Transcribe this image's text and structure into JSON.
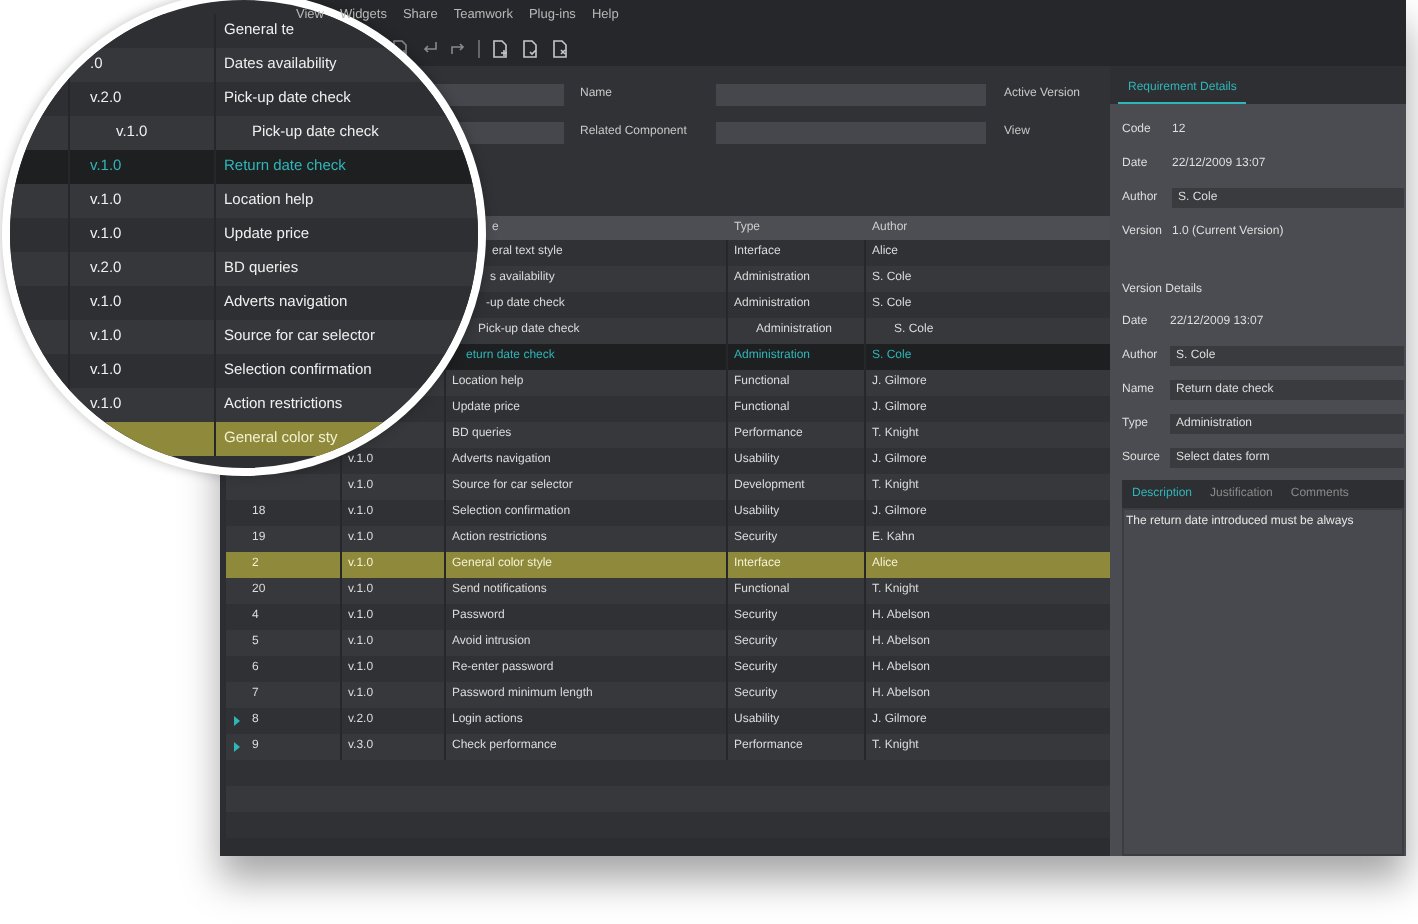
{
  "menu": [
    "View",
    "Widgets",
    "Share",
    "Teamwork",
    "Plug-ins",
    "Help"
  ],
  "form": [
    {
      "label": "Name",
      "side_label": "Active Version"
    },
    {
      "label": "Related Component",
      "side_label": "View"
    }
  ],
  "table": {
    "headers": {
      "name": "e",
      "type": "Type",
      "author": "Author"
    },
    "rows": [
      {
        "name": "eral text style",
        "type": "Interface",
        "author": "Alice",
        "selected": false,
        "highlighted": false
      },
      {
        "name": "s availability",
        "type": "Administration",
        "author": "S. Cole",
        "selected": false,
        "highlighted": false
      },
      {
        "name": "-up date check",
        "type": "Administration",
        "author": "S. Cole",
        "selected": false,
        "highlighted": false,
        "children": [
          {
            "name": "Pick-up date check",
            "type": "Administration",
            "author": "S. Cole",
            "selected": false,
            "highlighted": false
          }
        ]
      },
      {
        "name": "eturn date check",
        "type": "Administration",
        "author": "S. Cole",
        "selected": true,
        "highlighted": false
      },
      {
        "name": "Location help",
        "type": "Functional",
        "author": "J. Gilmore",
        "selected": false,
        "highlighted": false
      },
      {
        "name": "Update price",
        "type": "Functional",
        "author": "J. Gilmore",
        "selected": false,
        "highlighted": false
      },
      {
        "name": "BD queries",
        "type": "Performance",
        "author": "T. Knight",
        "selected": false,
        "highlighted": false
      },
      {
        "version": "v.1.0",
        "name": "Adverts navigation",
        "type": "Usability",
        "author": "J. Gilmore",
        "selected": false,
        "highlighted": false
      },
      {
        "version": "v.1.0",
        "name": "Source for car selector",
        "type": "Development",
        "author": "T. Knight",
        "selected": false,
        "highlighted": false
      },
      {
        "code": "18",
        "version": "v.1.0",
        "name": "Selection confirmation",
        "type": "Usability",
        "author": "J. Gilmore",
        "selected": false,
        "highlighted": false
      },
      {
        "code": "19",
        "version": "v.1.0",
        "name": "Action restrictions",
        "type": "Security",
        "author": "E. Kahn",
        "selected": false,
        "highlighted": false
      },
      {
        "code": "2",
        "version": "v.1.0",
        "name": "General color style",
        "type": "Interface",
        "author": "Alice",
        "selected": false,
        "highlighted": true
      },
      {
        "code": "20",
        "version": "v.1.0",
        "name": "Send notifications",
        "type": "Functional",
        "author": "T. Knight",
        "selected": false,
        "highlighted": false
      },
      {
        "code": "4",
        "version": "v.1.0",
        "name": "Password",
        "type": "Security",
        "author": "H. Abelson",
        "selected": false,
        "highlighted": false
      },
      {
        "code": "5",
        "version": "v.1.0",
        "name": "Avoid intrusion",
        "type": "Security",
        "author": "H. Abelson",
        "selected": false,
        "highlighted": false
      },
      {
        "code": "6",
        "version": "v.1.0",
        "name": "Re-enter password",
        "type": "Security",
        "author": "H. Abelson",
        "selected": false,
        "highlighted": false
      },
      {
        "code": "7",
        "version": "v.1.0",
        "name": "Password minimum length",
        "type": "Security",
        "author": "H. Abelson",
        "selected": false,
        "highlighted": false
      },
      {
        "code": "8",
        "version": "v.2.0",
        "name": "Login actions",
        "type": "Usability",
        "author": "J. Gilmore",
        "selected": false,
        "highlighted": false,
        "expanded": false
      },
      {
        "code": "9",
        "version": "v.3.0",
        "name": "Check performance",
        "type": "Performance",
        "author": "T. Knight",
        "selected": false,
        "highlighted": false,
        "expanded": false
      }
    ]
  },
  "magnifier": {
    "rows": [
      {
        "name": "General te",
        "selected": false,
        "highlighted": false
      },
      {
        "version": ".0",
        "name": "Dates availability",
        "selected": false,
        "highlighted": false
      },
      {
        "version": "v.2.0",
        "name": "Pick-up date check",
        "selected": false,
        "highlighted": false,
        "children": [
          {
            "version": "v.1.0",
            "name": "Pick-up date check",
            "selected": false,
            "highlighted": false
          }
        ]
      },
      {
        "version": "v.1.0",
        "name": "Return date check",
        "selected": true,
        "highlighted": false
      },
      {
        "version": "v.1.0",
        "name": "Location help",
        "selected": false,
        "highlighted": false
      },
      {
        "version": "v.1.0",
        "name": "Update price",
        "selected": false,
        "highlighted": false
      },
      {
        "version": "v.2.0",
        "name": "BD queries",
        "selected": false,
        "highlighted": false
      },
      {
        "version": "v.1.0",
        "name": "Adverts navigation",
        "selected": false,
        "highlighted": false
      },
      {
        "version": "v.1.0",
        "name": "Source for car selector",
        "selected": false,
        "highlighted": false
      },
      {
        "version": "v.1.0",
        "name": "Selection confirmation",
        "selected": false,
        "highlighted": false
      },
      {
        "version": "v.1.0",
        "name": "Action restrictions",
        "selected": false,
        "highlighted": false
      },
      {
        "name": "General color sty",
        "selected": false,
        "highlighted": true
      }
    ]
  },
  "details": {
    "tabs": [
      {
        "label": "Requirement Details",
        "selected": true
      }
    ],
    "fields": [
      {
        "kind": "text",
        "label": "Code",
        "value": "12"
      },
      {
        "kind": "text",
        "label": "Date",
        "value": "22/12/2009 13:07"
      },
      {
        "kind": "input",
        "label": "Author",
        "value": "S. Cole"
      },
      {
        "kind": "text",
        "label": "Version",
        "value": "1.0 (Current Version)"
      }
    ],
    "section_title": "Version Details",
    "version_fields": [
      {
        "kind": "text",
        "label": "Date",
        "value": "22/12/2009 13:07"
      },
      {
        "kind": "input",
        "label": "Author",
        "value": "S. Cole"
      },
      {
        "kind": "input",
        "label": "Name",
        "value": "Return date check"
      },
      {
        "kind": "input",
        "label": "Type",
        "value": "Administration"
      },
      {
        "kind": "input",
        "label": "Source",
        "value": "Select dates form"
      }
    ],
    "sub_tabs": [
      {
        "label": "Description",
        "selected": true
      },
      {
        "label": "Justification",
        "selected": false
      },
      {
        "label": "Comments",
        "selected": false
      }
    ],
    "description": "The return date introduced must be always"
  }
}
